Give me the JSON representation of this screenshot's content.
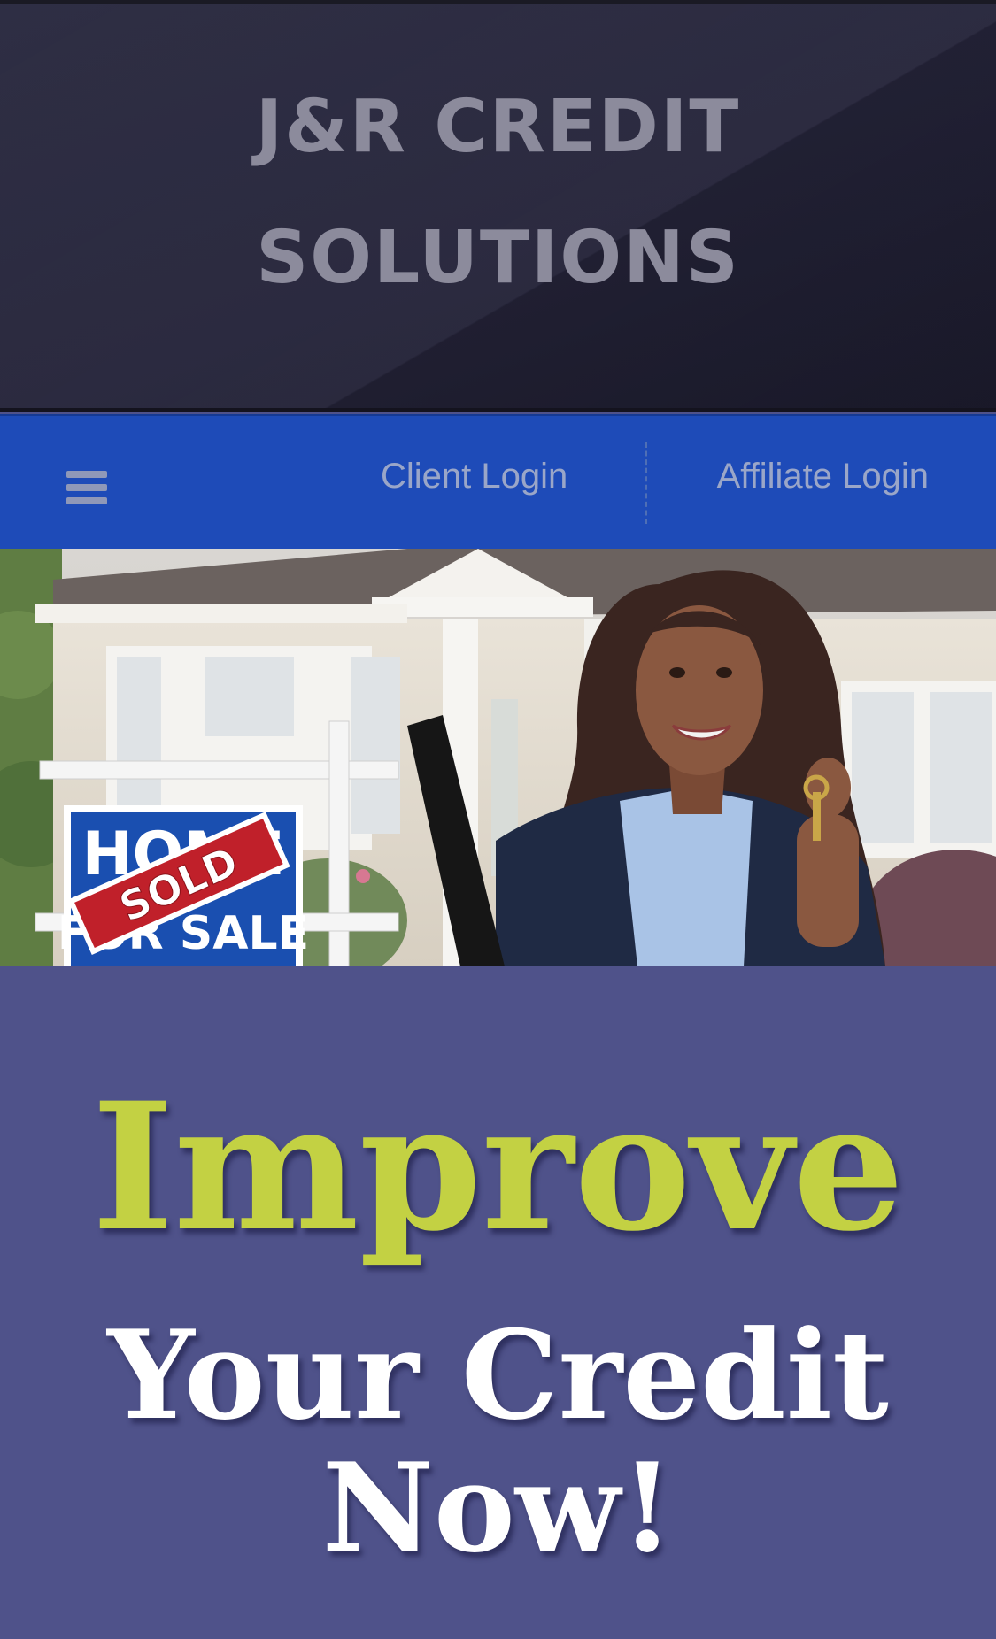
{
  "header": {
    "title_line_1": "J&R CREDIT",
    "title_line_2": "SOLUTIONS"
  },
  "nav": {
    "menu_icon": "hamburger-menu-icon",
    "client_login": "Client Login",
    "affiliate_login": "Affiliate Login"
  },
  "hero": {
    "sign_top": "HOME",
    "sign_bottom": "FOR SALE",
    "sign_overlay": "SOLD"
  },
  "cta": {
    "line_1": "Improve",
    "line_2": "Your Credit",
    "line_3": "Now!"
  },
  "colors": {
    "header_bg": "#25243a",
    "nav_bg": "#1e4bb8",
    "cta_bg": "#4f528a",
    "accent_green": "#c3d143",
    "sold_red": "#c0202a",
    "sign_blue": "#1a4fb0"
  }
}
